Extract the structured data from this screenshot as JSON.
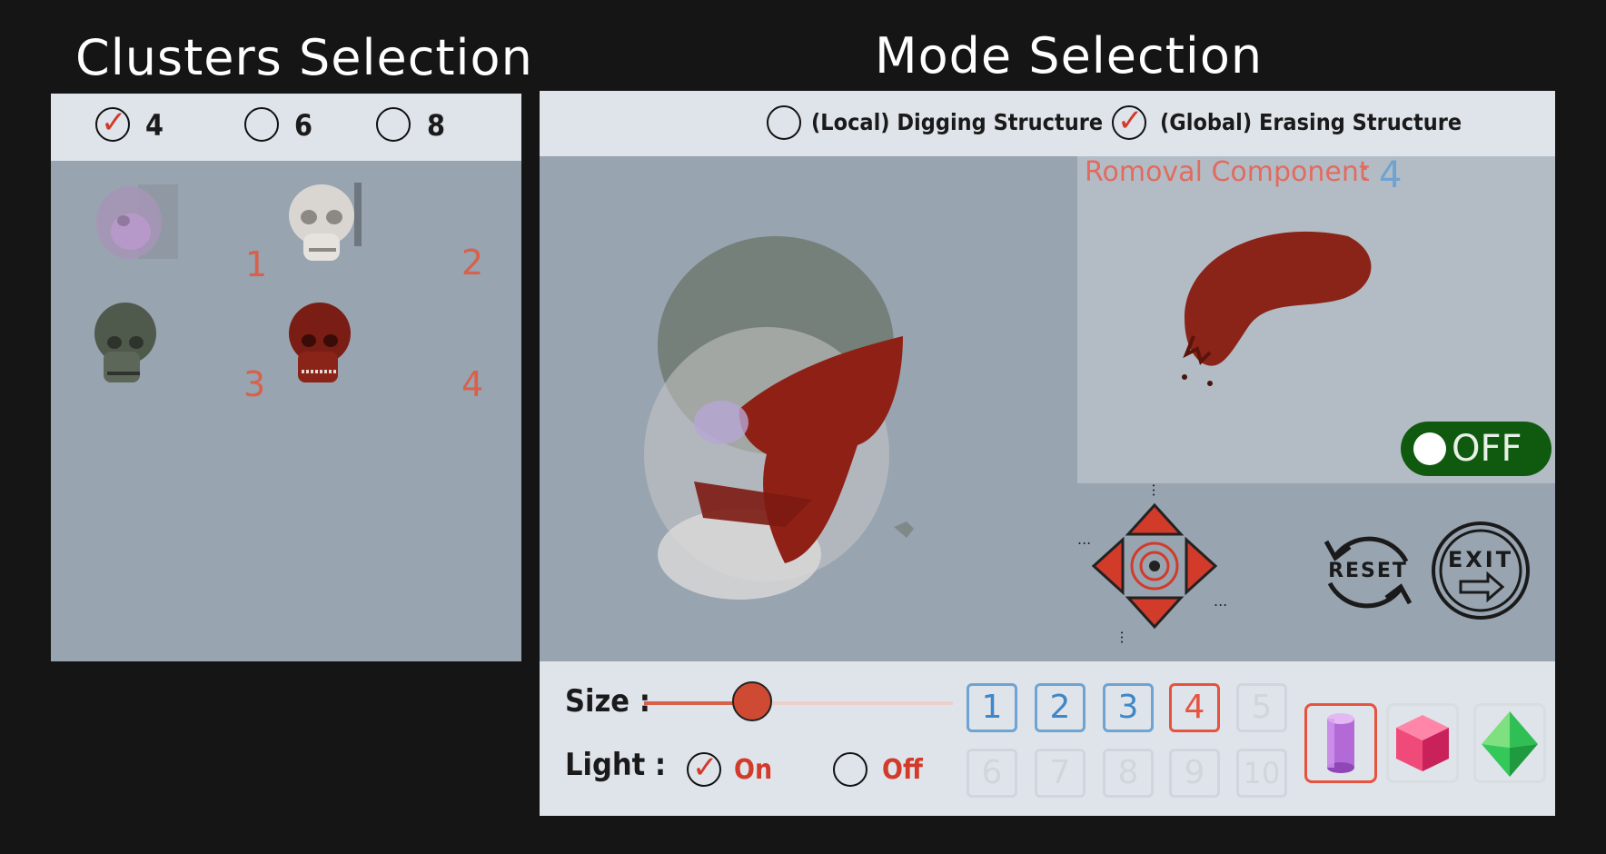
{
  "clusters": {
    "title": "Clusters Selection",
    "options": [
      {
        "label": "4",
        "checked": true
      },
      {
        "label": "6",
        "checked": false
      },
      {
        "label": "8",
        "checked": false
      }
    ],
    "thumbnails": [
      {
        "number": "1",
        "style": "translucent-purple"
      },
      {
        "number": "2",
        "style": "white-bone"
      },
      {
        "number": "3",
        "style": "dark-green"
      },
      {
        "number": "4",
        "style": "red-muscle"
      }
    ]
  },
  "mode": {
    "title": "Mode Selection",
    "options": [
      {
        "label": "(Local) Digging Structure",
        "checked": false
      },
      {
        "label": "(Global) Erasing Structure",
        "checked": true
      }
    ]
  },
  "preview": {
    "removal_label": "Romoval Component",
    "removal_sep": ":",
    "removal_value": "4",
    "toggle_label": "OFF"
  },
  "controls": {
    "reset_label": "RESET",
    "exit_label": "EXIT",
    "dpad_ellipsis": "..."
  },
  "bottom": {
    "size_label": "Size :",
    "size_value_fraction": 0.35,
    "light_label": "Light :",
    "light_options": [
      {
        "label": "On",
        "checked": true
      },
      {
        "label": "Off",
        "checked": false
      }
    ],
    "number_buttons": [
      "1",
      "2",
      "3",
      "4",
      "5",
      "6",
      "7",
      "8",
      "9",
      "10"
    ],
    "enabled_count": 4,
    "selected_number": "4",
    "shapes": [
      "cylinder-icon",
      "cube-icon",
      "octahedron-icon"
    ],
    "selected_shape": "cylinder-icon"
  },
  "colors": {
    "accent_red": "#e6533f",
    "accent_blue": "#3e87c8",
    "toggle_green": "#0f5a0f",
    "panel_gray": "#98a4b0",
    "bar_gray": "#dfe4ea"
  }
}
